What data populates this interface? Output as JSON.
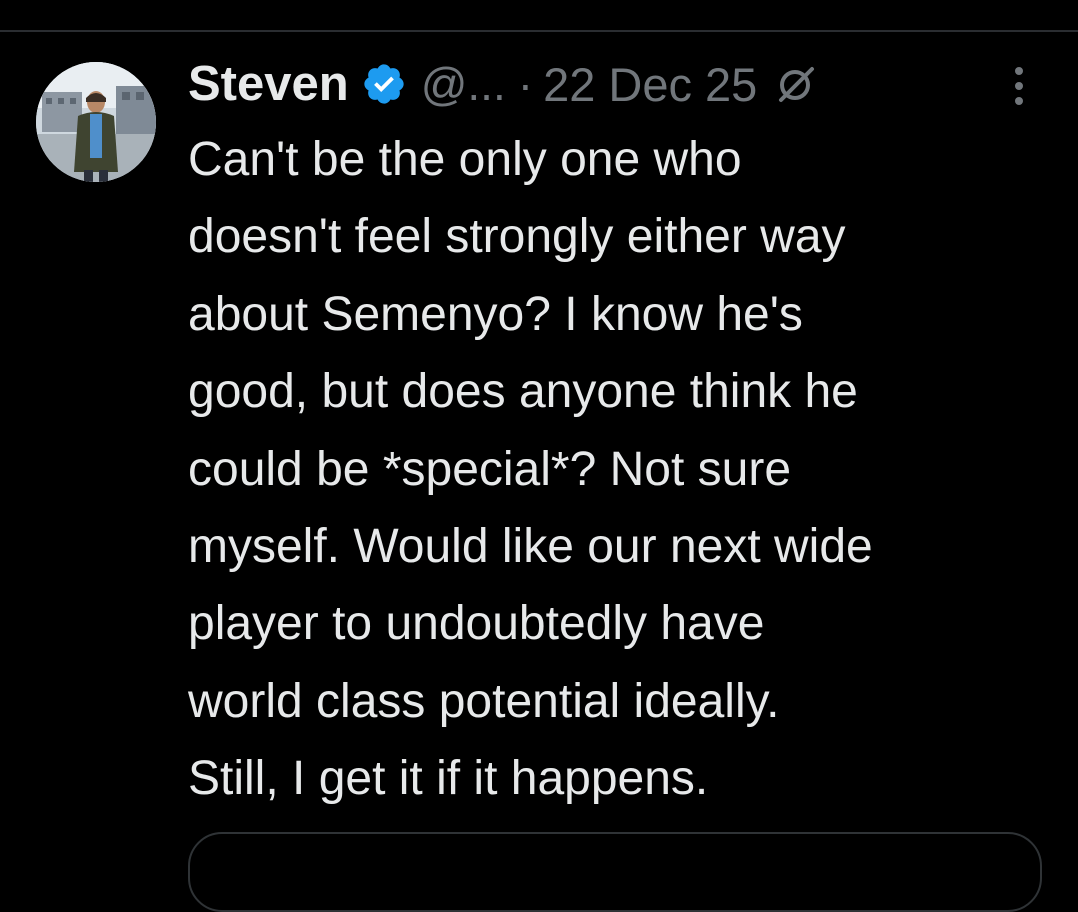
{
  "tweet": {
    "display_name": "Steven",
    "handle": "@...",
    "separator": "·",
    "timestamp": "22 Dec 25",
    "verified": true,
    "text": "Can't be the only one who\ndoesn't feel strongly either way\nabout Semenyo? I know he's\ngood, but does anyone think he\ncould be *special*? Not sure\nmyself. Would like our next wide\nplayer to undoubtedly have\nworld class potential ideally.\nStill, I get it if it happens.",
    "icons": {
      "verified": "verified-badge-icon",
      "grok": "grok-icon",
      "more": "more-options-icon",
      "avatar": "profile-photo"
    }
  },
  "colors": {
    "background": "#000000",
    "text_primary": "#e7e9ea",
    "text_secondary": "#71767b",
    "verified_blue": "#1d9bf0",
    "border": "#2f3336"
  }
}
